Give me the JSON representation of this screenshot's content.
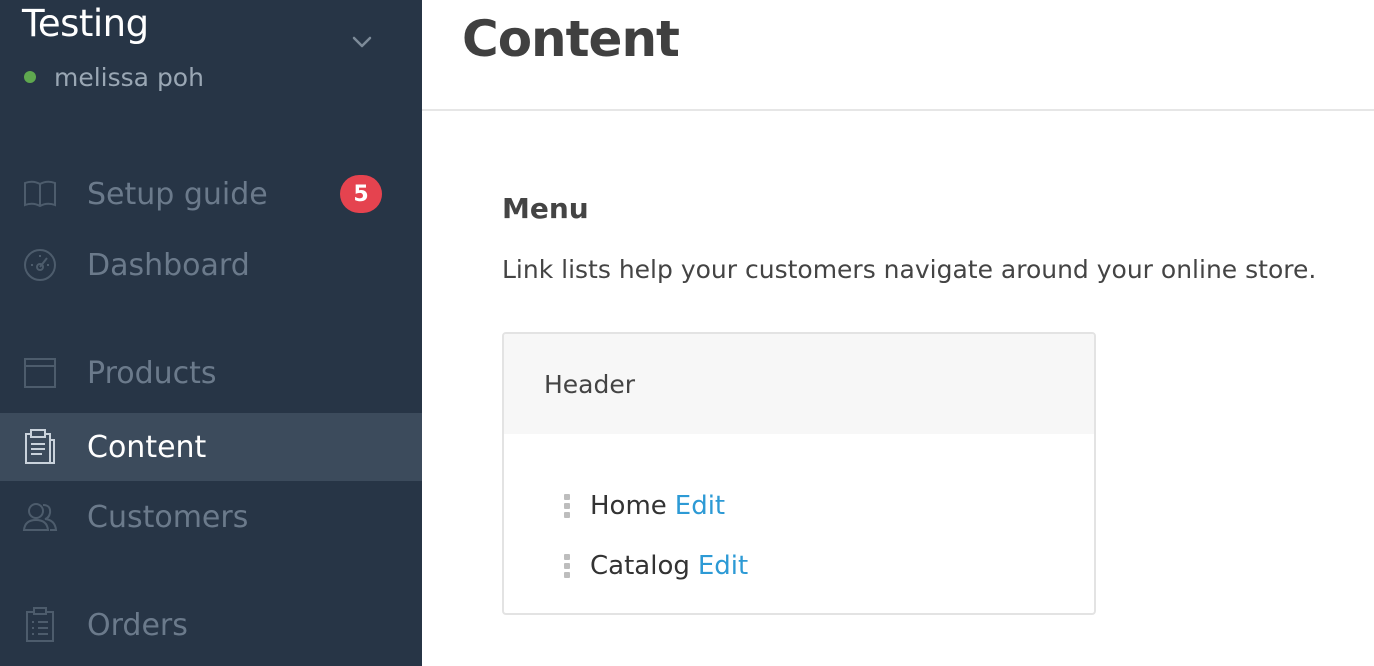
{
  "sidebar": {
    "store_name": "Testing",
    "user_name": "melissa poh",
    "items": [
      {
        "label": "Setup guide",
        "icon": "book-icon",
        "badge": "5"
      },
      {
        "label": "Dashboard",
        "icon": "speedometer-icon"
      },
      {
        "label": "Products",
        "icon": "box-icon"
      },
      {
        "label": "Content",
        "icon": "clipboard-icon",
        "active": true
      },
      {
        "label": "Customers",
        "icon": "users-icon"
      },
      {
        "label": "Orders",
        "icon": "orders-icon"
      }
    ]
  },
  "main": {
    "page_title": "Content",
    "section": {
      "title": "Menu",
      "description": "Link lists help your customers navigate around your online store."
    },
    "link_list": {
      "name": "Header",
      "links": [
        {
          "title": "Home",
          "action": "Edit"
        },
        {
          "title": "Catalog",
          "action": "Edit"
        }
      ]
    }
  },
  "colors": {
    "sidebar_bg": "#273546",
    "sidebar_active_bg": "#3c4b5c",
    "badge_red": "#e5434f",
    "online_green": "#5fa84f",
    "link_blue": "#2d9ad5"
  }
}
